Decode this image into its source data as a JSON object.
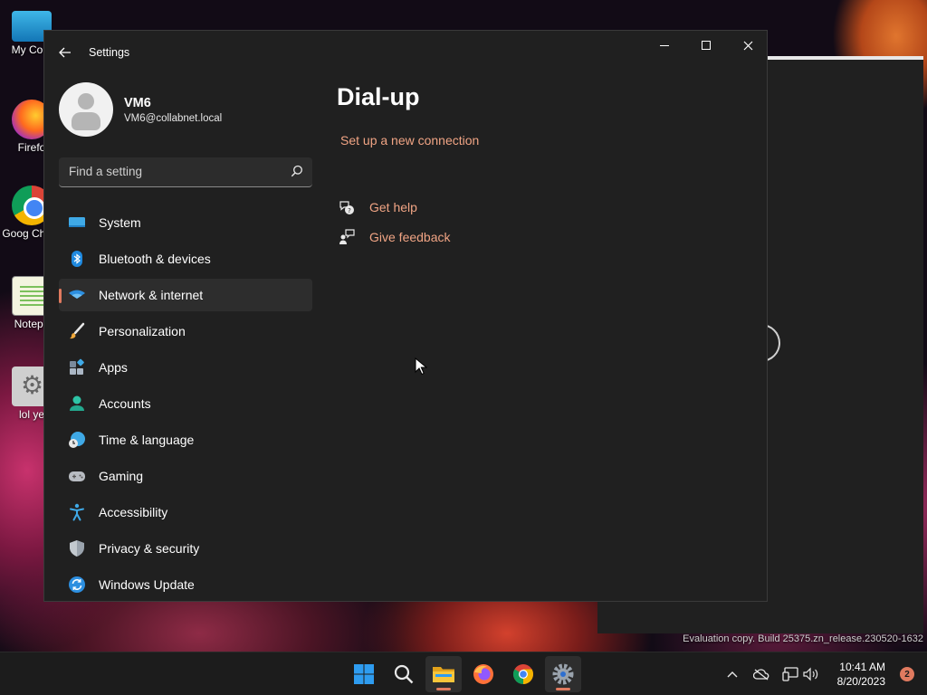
{
  "desktop": {
    "icons": [
      {
        "label": "My Com"
      },
      {
        "label": "Firefo"
      },
      {
        "label": "Goog Chron"
      },
      {
        "label": "Notepa"
      },
      {
        "label": "lol ye"
      }
    ],
    "watermark": "Evaluation copy. Build 25375.zn_release.230520-1632"
  },
  "window": {
    "title": "Settings",
    "back_icon": "back-arrow-icon",
    "controls": [
      "minimize",
      "maximize",
      "close"
    ]
  },
  "profile": {
    "name": "VM6",
    "email": "VM6@collabnet.local"
  },
  "search": {
    "placeholder": "Find a setting",
    "value": ""
  },
  "nav": {
    "items": [
      {
        "label": "System",
        "icon": "monitor-icon"
      },
      {
        "label": "Bluetooth & devices",
        "icon": "bluetooth-icon"
      },
      {
        "label": "Network & internet",
        "icon": "wifi-icon",
        "active": true
      },
      {
        "label": "Personalization",
        "icon": "paintbrush-icon"
      },
      {
        "label": "Apps",
        "icon": "apps-icon"
      },
      {
        "label": "Accounts",
        "icon": "person-icon"
      },
      {
        "label": "Time & language",
        "icon": "globe-clock-icon"
      },
      {
        "label": "Gaming",
        "icon": "gamepad-icon"
      },
      {
        "label": "Accessibility",
        "icon": "accessibility-icon"
      },
      {
        "label": "Privacy & security",
        "icon": "shield-icon"
      },
      {
        "label": "Windows Update",
        "icon": "update-icon"
      }
    ]
  },
  "main": {
    "title": "Dial-up",
    "setup_link": "Set up a new connection",
    "help_link": "Get help",
    "feedback_link": "Give feedback"
  },
  "taskbar": {
    "apps": [
      "start-icon",
      "search-icon",
      "file-explorer-icon",
      "firefox-icon",
      "chrome-icon",
      "settings-icon"
    ],
    "time": "10:41 AM",
    "date": "8/20/2023",
    "notification_count": "2"
  },
  "colors": {
    "accent": "#e07a5f",
    "link": "#f0a484",
    "window_bg": "#202020",
    "active_item_bg": "#2d2d2d"
  }
}
